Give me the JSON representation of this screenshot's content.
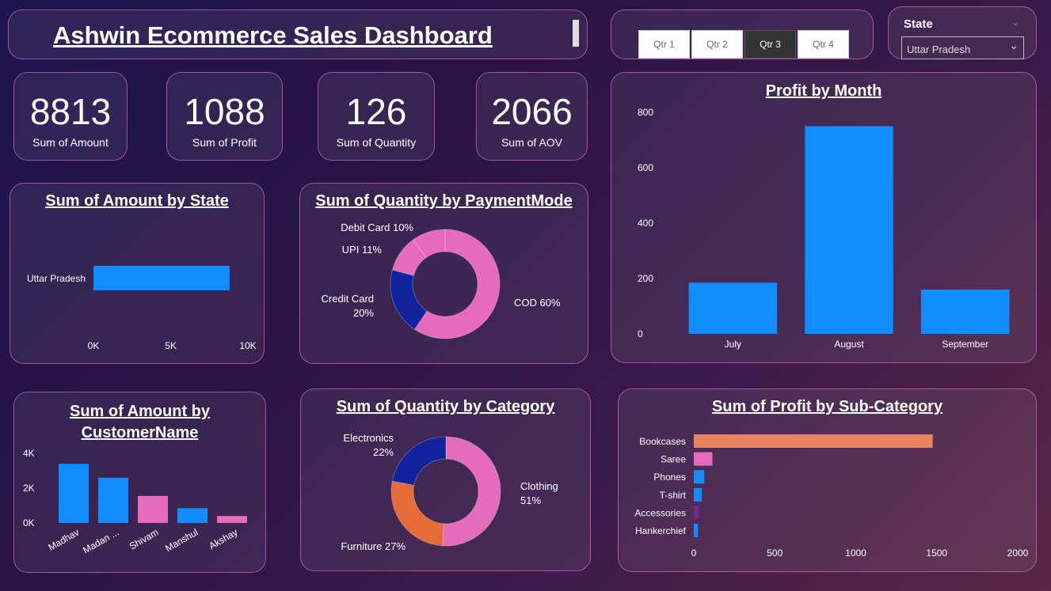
{
  "header": {
    "title": "Ashwin Ecommerce Sales Dashboard"
  },
  "quarters": [
    {
      "label": "Qtr 1",
      "active": false
    },
    {
      "label": "Qtr 2",
      "active": false
    },
    {
      "label": "Qtr 3",
      "active": true
    },
    {
      "label": "Qtr 4",
      "active": false
    }
  ],
  "state_filter": {
    "label": "State",
    "selected": "Uttar Pradesh"
  },
  "kpis": [
    {
      "value": "8813",
      "label": "Sum of Amount"
    },
    {
      "value": "1088",
      "label": "Sum of Profit"
    },
    {
      "value": "126",
      "label": "Sum of Quantity"
    },
    {
      "value": "2066",
      "label": "Sum of AOV"
    }
  ],
  "colors": {
    "blue": "#118dff",
    "pink": "#e66bbd",
    "navy": "#12239e",
    "orange": "#e66c37",
    "peach": "#e8845f",
    "purple": "#6b2c8e"
  },
  "chart_data": [
    {
      "id": "amount_by_state",
      "type": "bar",
      "orientation": "horizontal",
      "title": "Sum of Amount by State",
      "categories": [
        "Uttar Pradesh"
      ],
      "values": [
        8813
      ],
      "xlim": [
        0,
        10000
      ],
      "ticks": [
        0,
        5000,
        10000
      ],
      "tick_labels": [
        "0K",
        "5K",
        "10K"
      ],
      "colors": [
        "#118dff"
      ]
    },
    {
      "id": "quantity_by_paymentmode",
      "type": "pie",
      "donut": true,
      "title": "Sum of Quantity by PaymentMode",
      "categories": [
        "COD",
        "Credit Card",
        "UPI",
        "Debit Card"
      ],
      "values": [
        60,
        20,
        11,
        10
      ],
      "labels": [
        "COD 60%",
        "Credit Card 20%",
        "UPI 11%",
        "Debit Card 10%"
      ],
      "colors": [
        "#e66bbd",
        "#12239e",
        "#e66bbd",
        "#e66bbd"
      ]
    },
    {
      "id": "profit_by_month",
      "type": "bar",
      "title": "Profit by Month",
      "categories": [
        "July",
        "August",
        "September"
      ],
      "values": [
        185,
        750,
        160
      ],
      "ylim": [
        0,
        800
      ],
      "ticks": [
        0,
        200,
        400,
        600,
        800
      ],
      "colors": [
        "#118dff",
        "#118dff",
        "#118dff"
      ]
    },
    {
      "id": "amount_by_customer",
      "type": "bar",
      "title": "Sum of Amount by CustomerName",
      "categories": [
        "Madhav",
        "Madan ...",
        "Shivam",
        "Manshul",
        "Akshay"
      ],
      "values": [
        3400,
        2600,
        1550,
        850,
        400
      ],
      "ylim": [
        0,
        4000
      ],
      "ticks": [
        0,
        2000,
        4000
      ],
      "tick_labels": [
        "0K",
        "2K",
        "4K"
      ],
      "colors": [
        "#118dff",
        "#118dff",
        "#e66bbd",
        "#118dff",
        "#e66bbd"
      ]
    },
    {
      "id": "quantity_by_category",
      "type": "pie",
      "donut": true,
      "title": "Sum of Quantity by Category",
      "categories": [
        "Clothing",
        "Furniture",
        "Electronics"
      ],
      "values": [
        51,
        27,
        22
      ],
      "labels": [
        "Clothing 51%",
        "Furniture 27%",
        "Electronics 22%"
      ],
      "colors": [
        "#e66bbd",
        "#e66c37",
        "#12239e"
      ]
    },
    {
      "id": "profit_by_subcategory",
      "type": "bar",
      "orientation": "horizontal",
      "title": "Sum of Profit by Sub-Category",
      "categories": [
        "Bookcases",
        "Saree",
        "Phones",
        "T-shirt",
        "Accessories",
        "Hankerchief"
      ],
      "values": [
        1475,
        115,
        65,
        50,
        30,
        25
      ],
      "xlim": [
        0,
        2000
      ],
      "ticks": [
        0,
        500,
        1000,
        1500,
        2000
      ],
      "colors": [
        "#e8845f",
        "#e66bbd",
        "#118dff",
        "#118dff",
        "#6b2c8e",
        "#118dff"
      ]
    }
  ]
}
